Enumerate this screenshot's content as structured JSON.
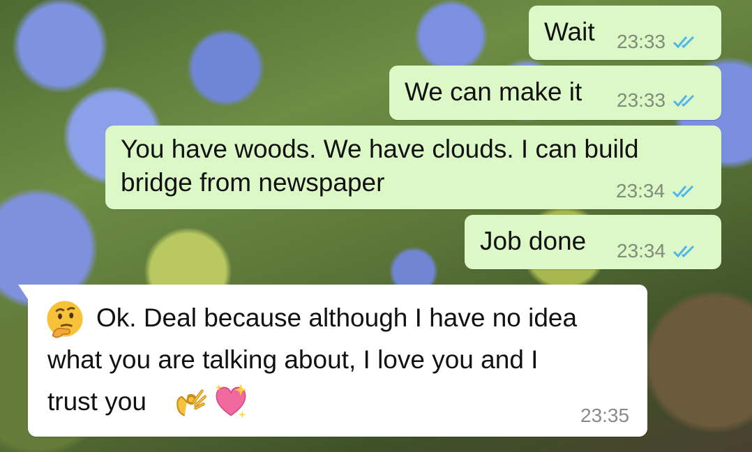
{
  "chat": {
    "messages": [
      {
        "direction": "outgoing",
        "text": "Wait",
        "time": "23:33",
        "status_icon": "double-check-read-icon"
      },
      {
        "direction": "outgoing",
        "text": "We can make it",
        "time": "23:33",
        "status_icon": "double-check-read-icon"
      },
      {
        "direction": "outgoing",
        "text_line1": "You have woods. We have clouds. I can build",
        "text_line2": "bridge from newspaper",
        "time": "23:34",
        "status_icon": "double-check-read-icon"
      },
      {
        "direction": "outgoing",
        "text": "Job done",
        "time": "23:34",
        "status_icon": "double-check-read-icon"
      },
      {
        "direction": "incoming",
        "text_line1": "Ok. Deal because although I have no idea",
        "text_line2": "what you are talking about, I love you and I",
        "text_line3": "trust you",
        "emojis": [
          "thinking-face-emoji",
          "ok-hand-emoji",
          "sparkling-heart-emoji"
        ],
        "time": "23:35"
      }
    ]
  },
  "colors": {
    "outgoing_bubble": "#dcf8c6",
    "incoming_bubble": "#ffffff",
    "read_ticks": "#4fb6ec"
  }
}
